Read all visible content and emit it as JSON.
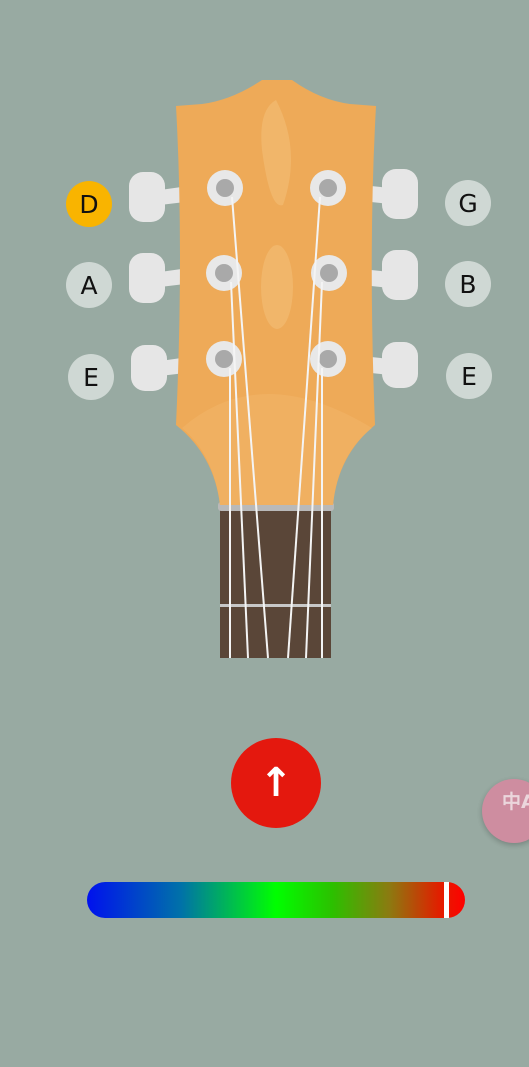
{
  "strings": {
    "left": [
      {
        "label": "D",
        "active": true
      },
      {
        "label": "A",
        "active": false
      },
      {
        "label": "E",
        "active": false
      }
    ],
    "right": [
      {
        "label": "G",
        "active": false
      },
      {
        "label": "B",
        "active": false
      },
      {
        "label": "E",
        "active": false
      }
    ]
  },
  "tuner": {
    "arrow_icon": "↑",
    "direction": "up",
    "pitch_position": 0.95
  },
  "translate_button": {
    "icon_text": "中A"
  },
  "colors": {
    "background": "#98aaa2",
    "headstock": "#eeaa58",
    "fretboard": "#5a4638",
    "active_string": "#f9b400",
    "inactive_string": "#cfd8d4",
    "arrow_button": "#e4180e"
  }
}
